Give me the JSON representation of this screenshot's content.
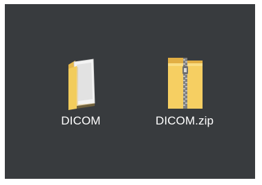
{
  "desktop": {
    "items": [
      {
        "label": "DICOM",
        "icon": "folder-with-documents-icon",
        "type": "folder"
      },
      {
        "label": "DICOM.zip",
        "icon": "zip-folder-icon",
        "type": "compressed-folder"
      }
    ]
  },
  "colors": {
    "background": "#383b3e",
    "folder_back": "#e6b84c",
    "folder_front": "#f7d56a",
    "paper": "#f0f0f0",
    "zipper": "#8a8a8a",
    "label_text": "#ffffff"
  }
}
